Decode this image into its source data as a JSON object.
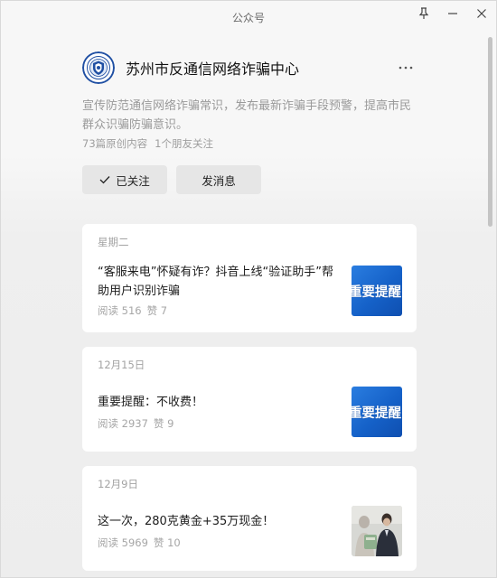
{
  "window": {
    "title": "公众号",
    "controls": {
      "pin_icon": "pin-icon",
      "minimize_icon": "minimize-icon",
      "close_icon": "close-icon"
    }
  },
  "account": {
    "name": "苏州市反通信网络诈骗中心",
    "description": "宣传防范通信网络诈骗常识，发布最新诈骗手段预警，提高市民群众识骗防骗意识。",
    "original_count": "73篇原创内容",
    "friends_following": "1个朋友关注",
    "colors": {
      "logo_blue": "#1f4fa3",
      "accent_thumb_blue": "#1561c8"
    }
  },
  "actions": {
    "follow_label": "已关注",
    "message_label": "发消息"
  },
  "articles": [
    {
      "date": "星期二",
      "title": "“客服来电”怀疑有诈？抖音上线“验证助手”帮助用户识别诈骗",
      "reads": "阅读 516",
      "likes": "赞 7",
      "thumb_text": "重要提醒"
    },
    {
      "date": "12月15日",
      "title": "重要提醒：不收费！",
      "reads": "阅读 2937",
      "likes": "赞 9",
      "thumb_text": "重要提醒"
    },
    {
      "date": "12月9日",
      "title": "这一次，280克黄金+35万现金！",
      "reads": "阅读 5969",
      "likes": "赞 10",
      "thumb_text": ""
    }
  ]
}
